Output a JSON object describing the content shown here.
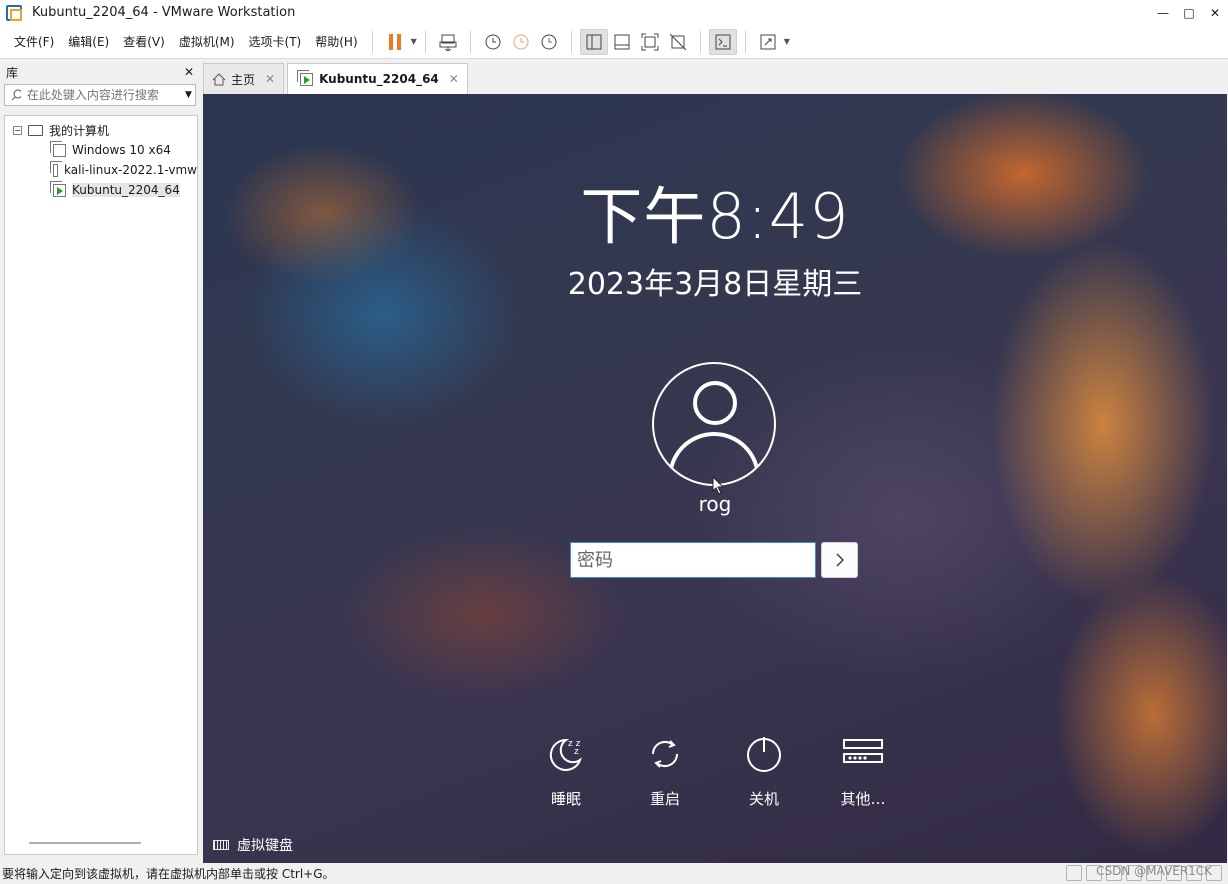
{
  "window": {
    "title": "Kubuntu_2204_64 - VMware Workstation",
    "controls": [
      "—",
      "□",
      "✕"
    ]
  },
  "menu": {
    "items": [
      "文件(F)",
      "编辑(E)",
      "查看(V)",
      "虚拟机(M)",
      "选项卡(T)",
      "帮助(H)"
    ]
  },
  "library": {
    "title": "库",
    "close": "✕",
    "search_placeholder": "在此处键入内容进行搜索",
    "tree": {
      "root": "我的计算机",
      "items": [
        "Windows 10 x64",
        "kali-linux-2022.1-vmw",
        "Kubuntu_2204_64"
      ]
    }
  },
  "tabs": [
    {
      "label": "主页",
      "close": "✕"
    },
    {
      "label": "Kubuntu_2204_64",
      "close": "✕"
    }
  ],
  "vm": {
    "time": "下午8:49",
    "date": "2023年3月8日星期三",
    "username": "rog",
    "password_placeholder": "密码",
    "actions": [
      {
        "label": "睡眠",
        "icon": "sleep-icon"
      },
      {
        "label": "重启",
        "icon": "restart-icon"
      },
      {
        "label": "关机",
        "icon": "shutdown-icon"
      },
      {
        "label": "其他…",
        "icon": "other-icon"
      }
    ],
    "virtual_keyboard": "虚拟键盘"
  },
  "status": {
    "message": "要将输入定向到该虚拟机，请在虚拟机内部单击或按 Ctrl+G。",
    "watermark": "CSDN @MAVER1CK"
  },
  "colors": {
    "pause_orange": "#f07820",
    "input_focus": "#3d8ee0"
  }
}
